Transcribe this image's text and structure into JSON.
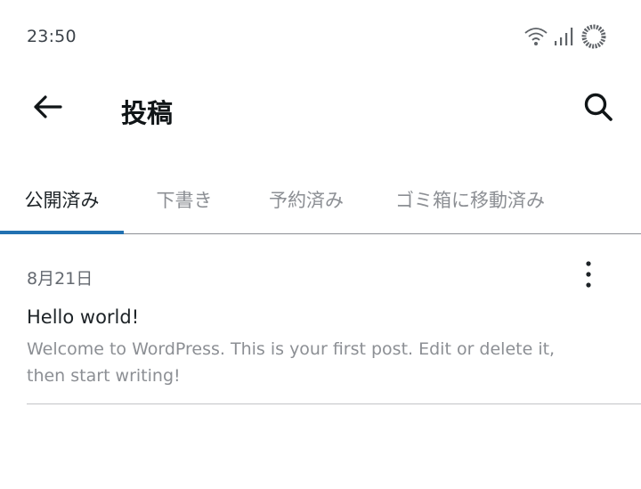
{
  "status": {
    "time": "23:50",
    "icons": [
      "wifi-icon",
      "signal-icon",
      "loading-icon"
    ]
  },
  "header": {
    "title": "投稿",
    "back_icon": "arrow-left-icon",
    "search_icon": "search-icon"
  },
  "tabs": [
    {
      "label": "公開済み",
      "active": true
    },
    {
      "label": "下書き",
      "active": false
    },
    {
      "label": "予約済み",
      "active": false
    },
    {
      "label": "ゴミ箱に移動済み",
      "active": false
    }
  ],
  "posts": [
    {
      "date": "8月21日",
      "title": "Hello world!",
      "excerpt": "Welcome to WordPress. This is your first post. Edit or delete it, then start writing!",
      "menu_icon": "more-vertical-icon"
    }
  ],
  "colors": {
    "accent": "#2271b1",
    "text": "#1d2327",
    "muted": "#8c8f94"
  }
}
